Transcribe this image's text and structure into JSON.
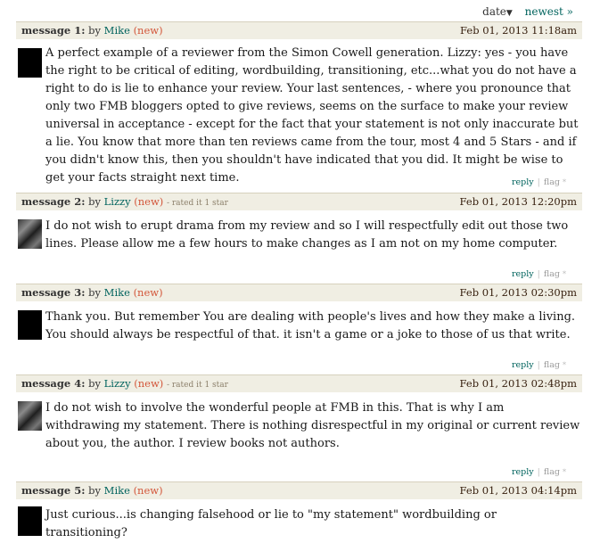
{
  "sort": {
    "date_label": "date",
    "newest_label": "newest »"
  },
  "actions": {
    "reply": "reply",
    "flag": "flag",
    "flag_mark": "*"
  },
  "messages": [
    {
      "num": "message 1:",
      "by": "by",
      "user": "Mike",
      "new": "(new)",
      "rated": "",
      "date": "Feb 01, 2013 11:18am",
      "text": "A perfect example of a reviewer from the Simon Cowell generation. Lizzy: yes - you have the right to be critical of editing, wordbuilding, transitioning, etc...what you do not have a right to do is lie to enhance your review. Your last sentences, - where you pronounce that only two FMB bloggers opted to give reviews, seems on the surface to make your review universal in acceptance - except for the fact that your statement is not only inaccurate but a lie. You know that more than ten reviews came from the tour, most 4 and 5 Stars - and if you didn't know this, then you shouldn't have indicated that you did. It might be wise to get your facts straight next time."
    },
    {
      "num": "message 2:",
      "by": "by",
      "user": "Lizzy",
      "new": "(new)",
      "rated": "- rated it 1 star",
      "date": "Feb 01, 2013 12:20pm",
      "text": "I do not wish to erupt drama from my review and so I will respectfully edit out those two lines. Please allow me a few hours to make changes as I am not on my home computer."
    },
    {
      "num": "message 3:",
      "by": "by",
      "user": "Mike",
      "new": "(new)",
      "rated": "",
      "date": "Feb 01, 2013 02:30pm",
      "text": "Thank you. But remember You are dealing with people's lives and how they make a living. You should always be respectful of that. it isn't a game or a joke to those of us that write."
    },
    {
      "num": "message 4:",
      "by": "by",
      "user": "Lizzy",
      "new": "(new)",
      "rated": "- rated it 1 star",
      "date": "Feb 01, 2013 02:48pm",
      "text": "I do not wish to involve the wonderful people at FMB in this. That is why I am withdrawing my statement. There is nothing disrespectful in my original or current review about you, the author. I review books not authors."
    },
    {
      "num": "message 5:",
      "by": "by",
      "user": "Mike",
      "new": "(new)",
      "rated": "",
      "date": "Feb 01, 2013 04:14pm",
      "text": "Just curious...is changing falsehood or lie to \"my statement\" wordbuilding or transitioning?"
    }
  ]
}
